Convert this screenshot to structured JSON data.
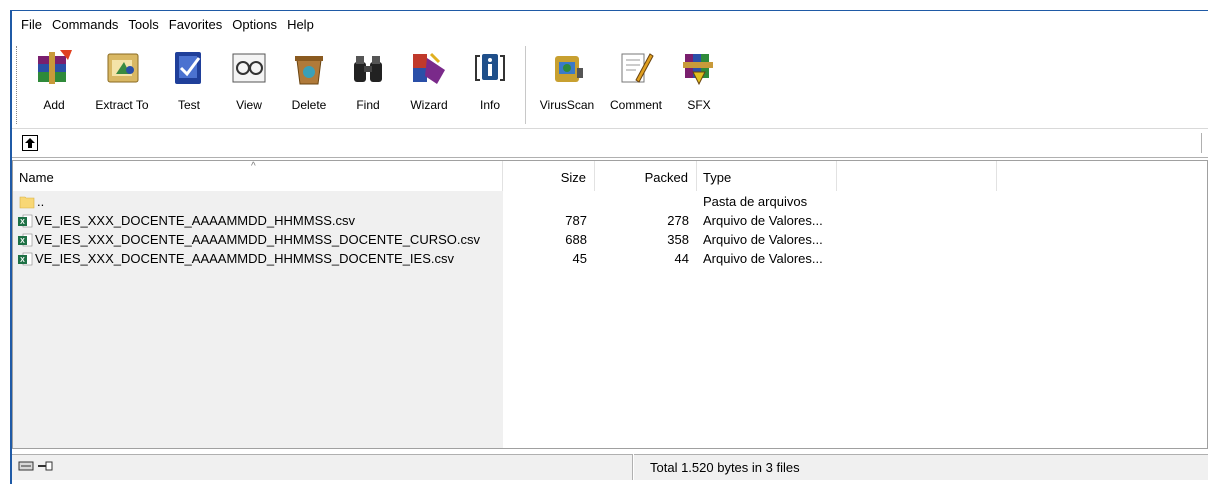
{
  "menu": [
    "File",
    "Commands",
    "Tools",
    "Favorites",
    "Options",
    "Help"
  ],
  "toolbar": {
    "buttons": [
      {
        "label": "Add",
        "icon": "add-archive-icon"
      },
      {
        "label": "Extract To",
        "icon": "extract-icon"
      },
      {
        "label": "Test",
        "icon": "test-icon"
      },
      {
        "label": "View",
        "icon": "view-icon"
      },
      {
        "label": "Delete",
        "icon": "delete-icon"
      },
      {
        "label": "Find",
        "icon": "find-binoculars-icon"
      },
      {
        "label": "Wizard",
        "icon": "wizard-icon"
      },
      {
        "label": "Info",
        "icon": "info-icon"
      },
      {
        "label": "VirusScan",
        "icon": "virus-scan-icon"
      },
      {
        "label": "Comment",
        "icon": "comment-icon"
      },
      {
        "label": "SFX",
        "icon": "sfx-icon"
      }
    ]
  },
  "columns": {
    "name": "Name",
    "size": "Size",
    "packed": "Packed",
    "type": "Type"
  },
  "rows": [
    {
      "name": "..",
      "size": "",
      "packed": "",
      "type": "Pasta de arquivos",
      "icon": "folder-icon"
    },
    {
      "name": "VE_IES_XXX_DOCENTE_AAAAMMDD_HHMMSS.csv",
      "size": "787",
      "packed": "278",
      "type": "Arquivo de Valores...",
      "icon": "csv-file-icon"
    },
    {
      "name": "VE_IES_XXX_DOCENTE_AAAAMMDD_HHMMSS_DOCENTE_CURSO.csv",
      "size": "688",
      "packed": "358",
      "type": "Arquivo de Valores...",
      "icon": "csv-file-icon"
    },
    {
      "name": "VE_IES_XXX_DOCENTE_AAAAMMDD_HHMMSS_DOCENTE_IES.csv",
      "size": "45",
      "packed": "44",
      "type": "Arquivo de Valores...",
      "icon": "csv-file-icon"
    }
  ],
  "status": {
    "summary": "Total 1.520 bytes in 3 files"
  },
  "colors": {
    "accent": "#1f5aa6",
    "excel_green": "#1e7145",
    "folder": "#f8d775"
  }
}
